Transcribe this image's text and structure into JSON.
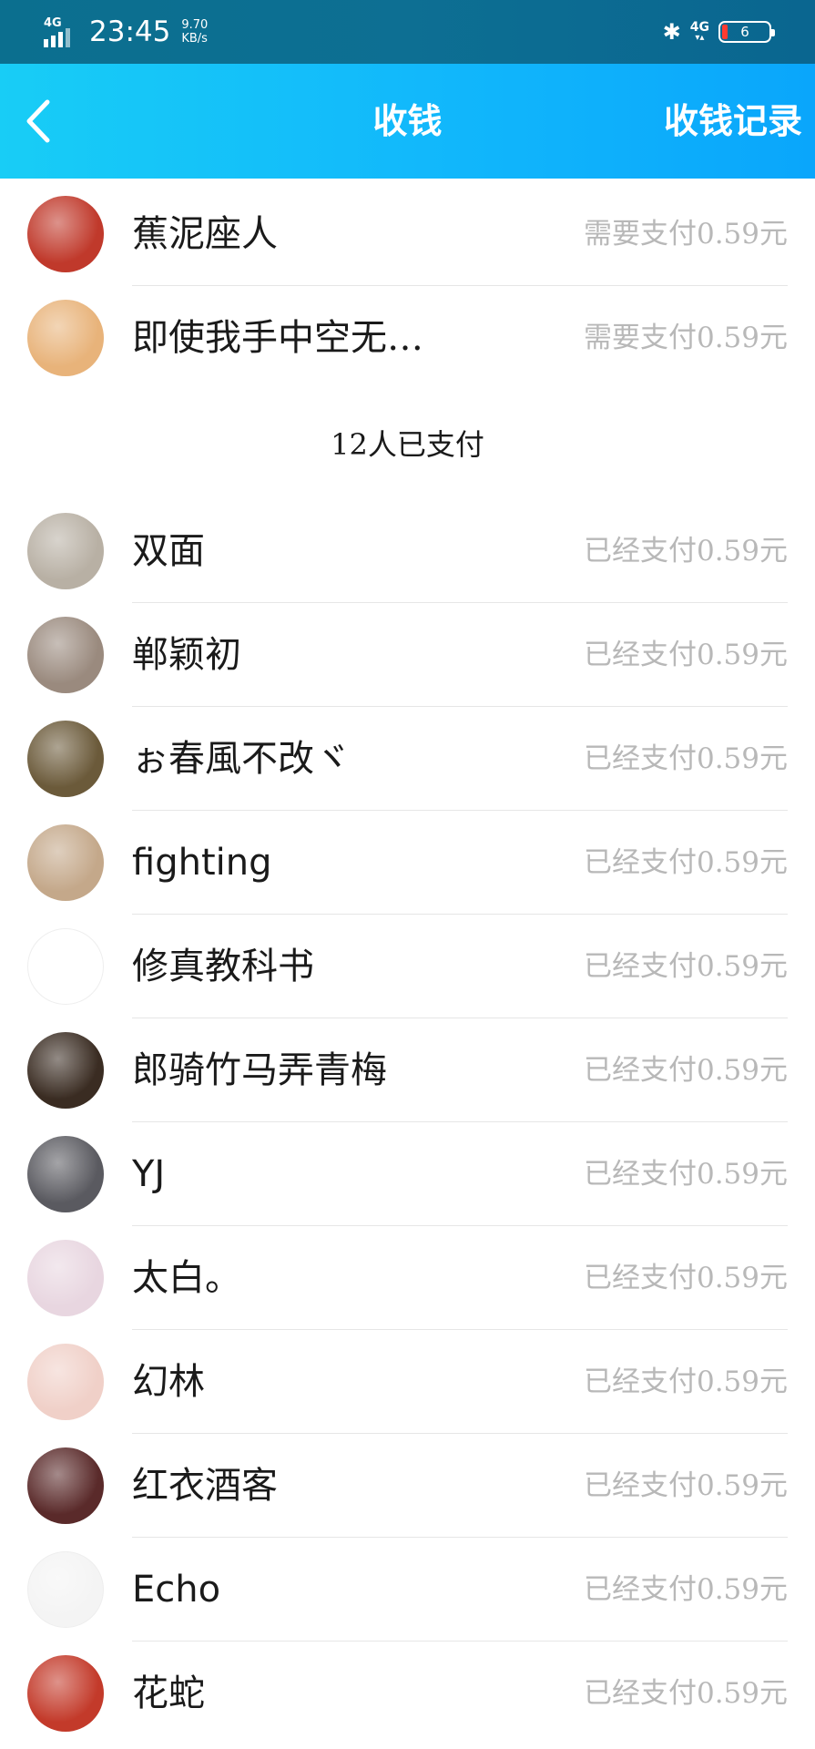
{
  "status_bar": {
    "network": "4G",
    "time": "23:45",
    "speed_value": "9.70",
    "speed_unit": "KB/s",
    "right_network": "4G",
    "battery": "6"
  },
  "header": {
    "title": "收钱",
    "records_label": "收钱记录"
  },
  "colors": {
    "header_start": "#18cdf6",
    "header_end": "#0aa6fb",
    "status_text": "#b8b8b8"
  },
  "unpaid": [
    {
      "name": "蕉泥座人",
      "status": "需要支付0.59元",
      "avatar": "red-dog-avatar",
      "color": "#c0392b"
    },
    {
      "name": "即使我手中空无…",
      "status": "需要支付0.59元",
      "avatar": "cat-avatar",
      "color": "#e8b37a"
    }
  ],
  "paid_header": "12人已支付",
  "paid": [
    {
      "name": "双面",
      "status": "已经支付0.59元",
      "avatar": "stairs-avatar",
      "color": "#b8b0a4"
    },
    {
      "name": "郸颖初",
      "status": "已经支付0.59元",
      "avatar": "anime-girl-avatar",
      "color": "#9a8a7e"
    },
    {
      "name": "ぉ春風不改ヾ",
      "status": "已经支付0.59元",
      "avatar": "plant-avatar",
      "color": "#6b5a3a"
    },
    {
      "name": "fighting",
      "status": "已经支付0.59元",
      "avatar": "elder-avatar",
      "color": "#c4a88a"
    },
    {
      "name": "修真教科书",
      "status": "已经支付0.59元",
      "avatar": "sketch-avatar",
      "color": "#ffffff"
    },
    {
      "name": "郎骑竹马弄青梅",
      "status": "已经支付0.59元",
      "avatar": "night-avatar",
      "color": "#3a2c22"
    },
    {
      "name": "YJ",
      "status": "已经支付0.59元",
      "avatar": "hand-avatar",
      "color": "#5a5a60"
    },
    {
      "name": "太白。",
      "status": "已经支付0.59元",
      "avatar": "anime-boy-avatar",
      "color": "#e8d6e0"
    },
    {
      "name": "幻林",
      "status": "已经支付0.59元",
      "avatar": "drawing-avatar",
      "color": "#f0d0c8"
    },
    {
      "name": "红衣酒客",
      "status": "已经支付0.59元",
      "avatar": "man-avatar",
      "color": "#5a2a2a"
    },
    {
      "name": "Echo",
      "status": "已经支付0.59元",
      "avatar": "lineart-avatar",
      "color": "#f4f4f4"
    },
    {
      "name": "花蛇",
      "status": "已经支付0.59元",
      "avatar": "masked-avatar",
      "color": "#c33a2a"
    }
  ]
}
